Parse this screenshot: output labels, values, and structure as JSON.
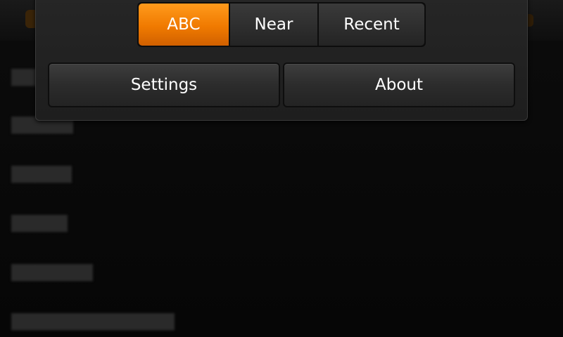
{
  "filter": {
    "options": [
      "ABC",
      "Near",
      "Recent"
    ],
    "selected": "ABC"
  },
  "menu": {
    "settings_label": "Settings",
    "about_label": "About"
  },
  "colors": {
    "accent": "#f07a00",
    "panel": "#222222",
    "background": "#000000"
  }
}
